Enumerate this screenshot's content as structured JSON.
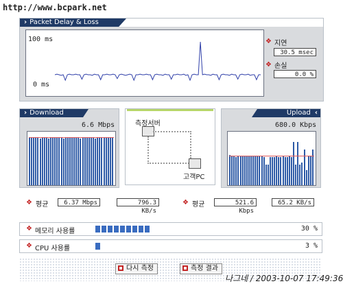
{
  "watermark": "http://www.bcpark.net",
  "signature": "나그네 / 2003-10-07 17:49:36",
  "packet": {
    "title": "Packet Delay & Loss",
    "y_max_label": "100 ms",
    "y_min_label": "0 ms",
    "delay_label": "지연",
    "delay_value": "30.5 msec",
    "loss_label": "손실",
    "loss_value": "0.0 %",
    "chart_data": {
      "type": "line",
      "x": [
        0,
        1,
        2,
        3,
        4,
        5,
        6,
        7,
        8,
        9,
        10,
        11,
        12,
        13,
        14,
        15,
        16,
        17,
        18,
        19,
        20,
        21,
        22,
        23,
        24,
        25,
        26,
        27,
        28,
        29,
        30,
        31,
        32,
        33,
        34,
        35,
        36,
        37,
        38,
        39,
        40,
        41,
        42,
        43,
        44,
        45,
        46,
        47,
        48,
        49,
        50,
        51,
        52,
        53,
        54,
        55,
        56,
        57,
        58,
        59,
        60,
        61,
        62,
        63,
        64,
        65,
        66,
        67,
        68,
        69,
        70,
        71,
        72,
        73,
        74,
        75,
        76,
        77,
        78,
        79,
        80,
        81,
        82,
        83,
        84,
        85,
        86,
        87,
        88,
        89,
        90,
        91,
        92,
        93,
        94,
        95,
        96,
        97,
        98,
        99
      ],
      "values": [
        30,
        31,
        30,
        29,
        30,
        20,
        30,
        31,
        30,
        30,
        31,
        30,
        30,
        22,
        30,
        31,
        30,
        30,
        29,
        31,
        30,
        30,
        21,
        30,
        30,
        31,
        30,
        30,
        31,
        30,
        23,
        30,
        31,
        30,
        29,
        30,
        31,
        30,
        20,
        30,
        30,
        31,
        30,
        30,
        31,
        30,
        30,
        21,
        30,
        31,
        30,
        30,
        29,
        31,
        30,
        30,
        22,
        30,
        30,
        31,
        30,
        30,
        31,
        29,
        30,
        20,
        30,
        31,
        30,
        30,
        90,
        30,
        31,
        30,
        30,
        29,
        31,
        30,
        30,
        21,
        30,
        31,
        30,
        30,
        29,
        31,
        30,
        30,
        22,
        30,
        31,
        30,
        30,
        31,
        29,
        30,
        30,
        21,
        30,
        30
      ],
      "ylim": [
        0,
        100
      ]
    }
  },
  "download": {
    "title": "Download",
    "speed": "6.6 Mbps",
    "avg_label": "평균",
    "avg_value": "6.37 Mbps",
    "avg_kb": "796.3 KB/s",
    "chart_data": {
      "type": "bar",
      "values": [
        94,
        94,
        94,
        94,
        94,
        92,
        94,
        94,
        94,
        92,
        94,
        94,
        94,
        94,
        94,
        94,
        92,
        94,
        94,
        94,
        94,
        94,
        94,
        94,
        92,
        94,
        94,
        94,
        94,
        94,
        94,
        92,
        94,
        94,
        94,
        94,
        94,
        94,
        94,
        94
      ],
      "ylim": [
        0,
        100
      ]
    }
  },
  "upload": {
    "title": "Upload",
    "speed": "680.0 Kbps",
    "avg_label": "평균",
    "avg_value": "521.6 Kbps",
    "avg_kb": "65.2 KB/s",
    "chart_data": {
      "type": "bar",
      "values": [
        60,
        58,
        58,
        56,
        58,
        58,
        58,
        58,
        58,
        58,
        58,
        58,
        58,
        58,
        58,
        58,
        56,
        40,
        40,
        56,
        56,
        56,
        58,
        56,
        56,
        58,
        56,
        56,
        58,
        56,
        85,
        40,
        85,
        40,
        45,
        70,
        30,
        58,
        58,
        70
      ],
      "ylim": [
        0,
        100
      ]
    }
  },
  "diagram": {
    "server_label": "측정서버",
    "client_label": "고객PC"
  },
  "memory": {
    "label": "메모리 사용률",
    "value": "30 %",
    "fraction": 0.3
  },
  "cpu": {
    "label": "CPU 사용률",
    "value": "3 %",
    "fraction": 0.03
  },
  "buttons": {
    "remeasure": "다시 측정",
    "results": "측정 결과"
  }
}
